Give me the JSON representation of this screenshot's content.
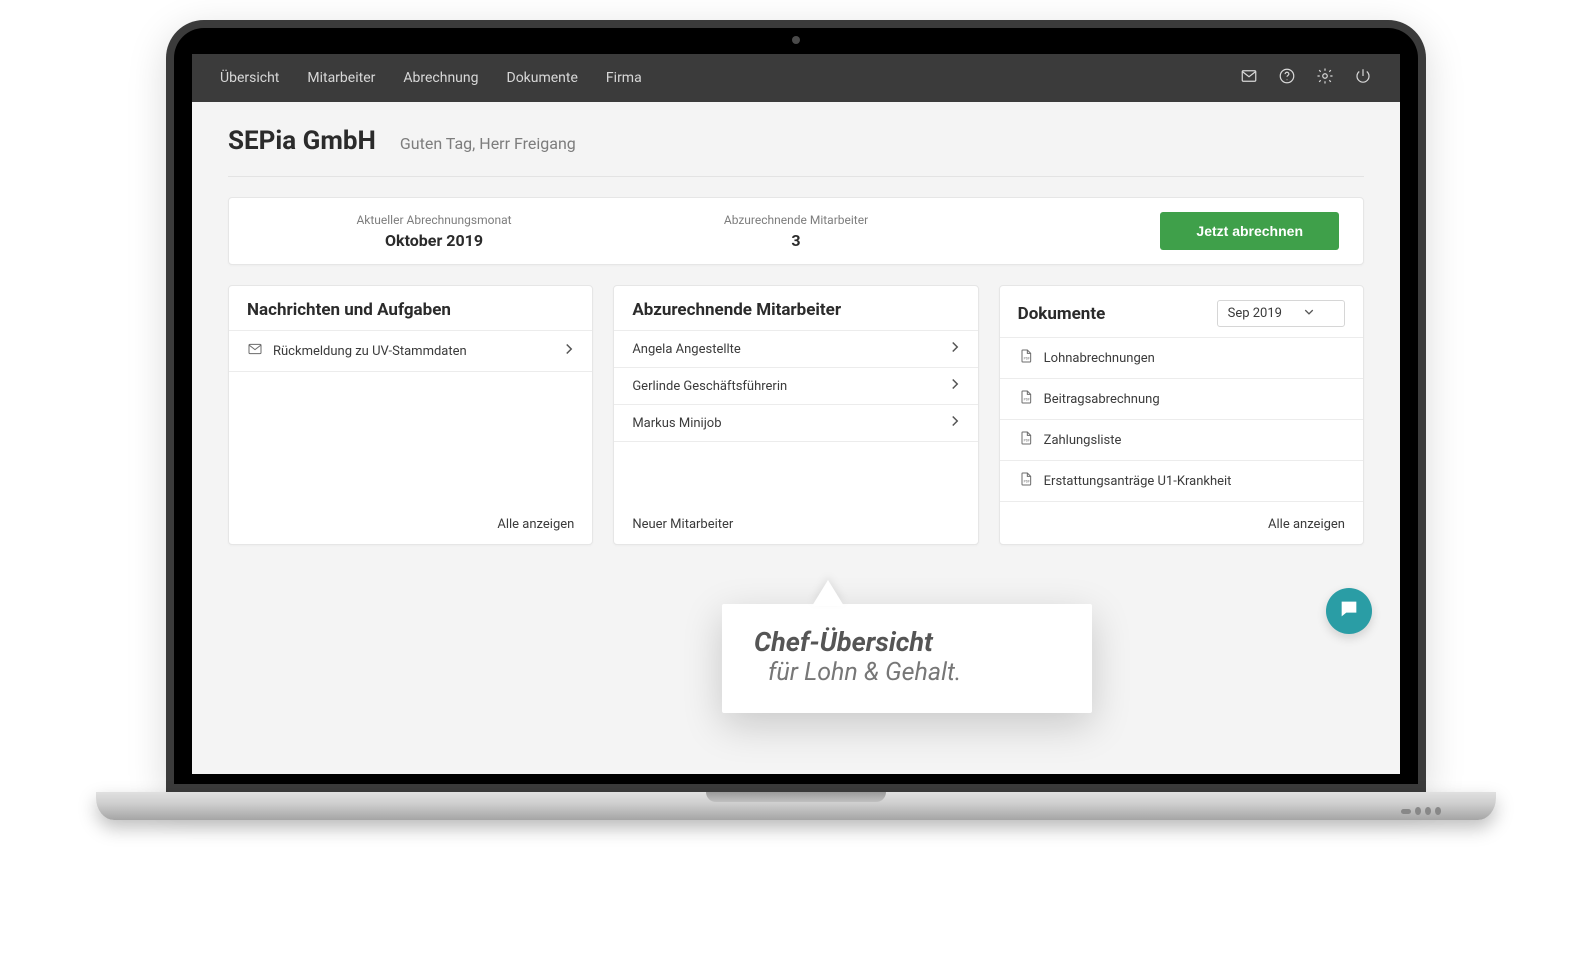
{
  "nav": {
    "items": [
      "Übersicht",
      "Mitarbeiter",
      "Abrechnung",
      "Dokumente",
      "Firma"
    ]
  },
  "header": {
    "company": "SEPia GmbH",
    "greeting": "Guten Tag, Herr Freigang"
  },
  "summary": {
    "month_label": "Aktueller Abrechnungsmonat",
    "month_value": "Oktober 2019",
    "employees_label": "Abzurechnende Mitarbeiter",
    "employees_value": "3",
    "cta": "Jetzt abrechnen"
  },
  "messages": {
    "title": "Nachrichten und Aufgaben",
    "items": [
      {
        "label": "Rückmeldung zu UV-Stammdaten"
      }
    ],
    "footer": "Alle anzeigen"
  },
  "employees": {
    "title": "Abzurechnende Mitarbeiter",
    "items": [
      {
        "label": "Angela Angestellte"
      },
      {
        "label": "Gerlinde Geschäftsführerin"
      },
      {
        "label": "Markus Minijob"
      }
    ],
    "footer": "Neuer Mitarbeiter"
  },
  "documents": {
    "title": "Dokumente",
    "selected_month": "Sep 2019",
    "items": [
      {
        "label": "Lohnabrechnungen"
      },
      {
        "label": "Beitragsabrechnung"
      },
      {
        "label": "Zahlungsliste"
      },
      {
        "label": "Erstattungsanträge U1-Krankheit"
      }
    ],
    "footer": "Alle anzeigen"
  },
  "callout": {
    "title": "Chef-Übersicht",
    "subtitle": "für Lohn & Gehalt."
  },
  "colors": {
    "primary_green": "#3fa04a",
    "chat_teal": "#2a9da5",
    "header_bg": "#3b3b3b"
  }
}
